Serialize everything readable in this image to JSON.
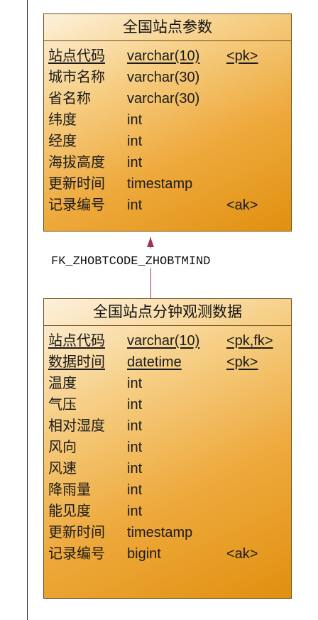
{
  "entities": [
    {
      "title": "全国站点参数",
      "columns": [
        {
          "name": "站点代码",
          "type": "varchar(10)",
          "key": "<pk>",
          "underline": true
        },
        {
          "name": "城市名称",
          "type": "varchar(30)",
          "key": "",
          "underline": false
        },
        {
          "name": "省名称",
          "type": "varchar(30)",
          "key": "",
          "underline": false
        },
        {
          "name": "纬度",
          "type": "int",
          "key": "",
          "underline": false
        },
        {
          "name": "经度",
          "type": "int",
          "key": "",
          "underline": false
        },
        {
          "name": "海拔高度",
          "type": "int",
          "key": "",
          "underline": false
        },
        {
          "name": "更新时间",
          "type": "timestamp",
          "key": "",
          "underline": false
        },
        {
          "name": "记录编号",
          "type": "int",
          "key": "<ak>",
          "underline": false
        }
      ]
    },
    {
      "title": "全国站点分钟观测数据",
      "columns": [
        {
          "name": "站点代码",
          "type": "varchar(10)",
          "key": "<pk,fk>",
          "underline": true
        },
        {
          "name": "数据时间",
          "type": "datetime",
          "key": "<pk>",
          "underline": true
        },
        {
          "name": "温度",
          "type": "int",
          "key": "",
          "underline": false
        },
        {
          "name": "气压",
          "type": "int",
          "key": "",
          "underline": false
        },
        {
          "name": "相对湿度",
          "type": "int",
          "key": "",
          "underline": false
        },
        {
          "name": "风向",
          "type": "int",
          "key": "",
          "underline": false
        },
        {
          "name": "风速",
          "type": "int",
          "key": "",
          "underline": false
        },
        {
          "name": "降雨量",
          "type": "int",
          "key": "",
          "underline": false
        },
        {
          "name": "能见度",
          "type": "int",
          "key": "",
          "underline": false
        },
        {
          "name": "更新时间",
          "type": "timestamp",
          "key": "",
          "underline": false
        },
        {
          "name": "记录编号",
          "type": "bigint",
          "key": "<ak>",
          "underline": false
        }
      ]
    }
  ],
  "relationship": {
    "label": "FK_ZHOBTCODE_ZHOBTMIND",
    "color": "#a3315a"
  },
  "colors": {
    "entity_border": "#6b4a12",
    "entity_fill_dark": "#e1900f",
    "entity_fill_light": "#fdf1dc"
  }
}
